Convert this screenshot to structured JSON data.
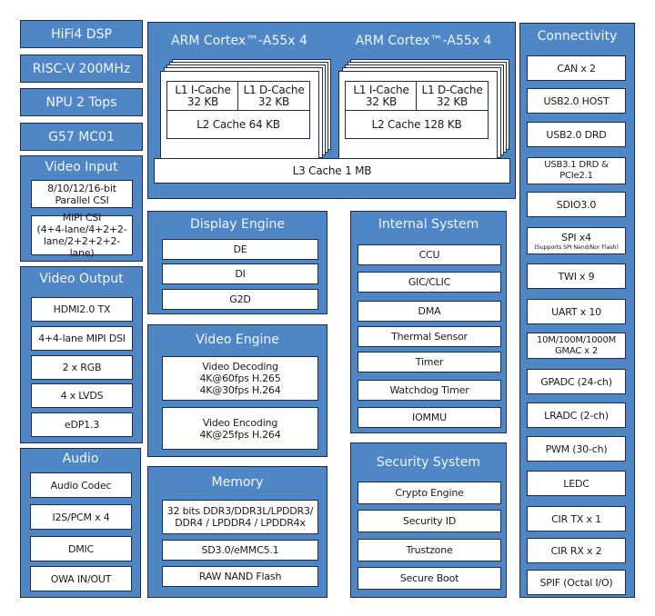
{
  "colors": {
    "block_fill": "#4f86c6",
    "border": "#1f2d44",
    "title_text": "#f2f6fb",
    "cell_fill": "#ffffff"
  },
  "left": {
    "standalone": [
      "HiFi4 DSP",
      "RISC-V 200MHz",
      "NPU 2 Tops",
      "G57 MC01"
    ],
    "video_input": {
      "title": "Video Input",
      "items": [
        [
          "8/10/12/16-bit",
          "Parallel CSI"
        ],
        [
          "MIPI CSI",
          "(4+4-lane/4+2+2-",
          "lane/2+2+2+2-lane)"
        ]
      ]
    },
    "video_output": {
      "title": "Video Output",
      "items": [
        "HDMI2.0 TX",
        "4+4-lane MIPI DSI",
        "2 x RGB",
        "4 x LVDS",
        "eDP1.3"
      ]
    },
    "audio": {
      "title": "Audio",
      "items": [
        "Audio Codec",
        "I2S/PCM x 4",
        "DMIC",
        "OWA IN/OUT"
      ]
    }
  },
  "cpu": {
    "clusters": [
      {
        "title": "ARM Cortex™-A55x 4",
        "l1i": [
          "L1 I-Cache",
          "32 KB"
        ],
        "l1d": [
          "L1 D-Cache",
          "32 KB"
        ],
        "l2": "L2 Cache 64 KB"
      },
      {
        "title": "ARM Cortex™-A55x 4",
        "l1i": [
          "L1 I-Cache",
          "32 KB"
        ],
        "l1d": [
          "L1 D-Cache",
          "32 KB"
        ],
        "l2": "L2 Cache 128 KB"
      }
    ],
    "l3": "L3 Cache 1 MB"
  },
  "display_engine": {
    "title": "Display Engine",
    "items": [
      "DE",
      "DI",
      "G2D"
    ]
  },
  "video_engine": {
    "title": "Video Engine",
    "items": [
      [
        "Video Decoding",
        "4K@60fps H.265",
        "4K@30fps H.264"
      ],
      [
        "Video Encoding",
        "4K@25fps H.264"
      ]
    ]
  },
  "memory": {
    "title": "Memory",
    "items": [
      [
        "32 bits DDR3/DDR3L/LPDDR3/",
        "DDR4 / LPDDR4 / LPDDR4x"
      ],
      [
        "SD3.0/eMMC5.1"
      ],
      [
        "RAW NAND Flash"
      ]
    ]
  },
  "internal_system": {
    "title": "Internal System",
    "items": [
      "CCU",
      "GIC/CLIC",
      "DMA",
      "Thermal Sensor",
      "Timer",
      "Watchdog Timer",
      "IOMMU"
    ]
  },
  "security_system": {
    "title": "Security System",
    "items": [
      "Crypto Engine",
      "Security ID",
      "Trustzone",
      "Secure Boot"
    ]
  },
  "connectivity": {
    "title": "Connectivity",
    "items": [
      [
        "CAN x 2"
      ],
      [
        "USB2.0 HOST"
      ],
      [
        "USB2.0 DRD"
      ],
      [
        "USB3.1 DRD &",
        "PCIe2.1"
      ],
      [
        "SDIO3.0"
      ],
      [
        "SPI x4"
      ],
      [
        "TWI x 9"
      ],
      [
        "UART x 10"
      ],
      [
        "10M/100M/1000M",
        "GMAC x 2"
      ],
      [
        "GPADC (24-ch)"
      ],
      [
        "LRADC (2-ch)"
      ],
      [
        "PWM (30-ch)"
      ],
      [
        "LEDC"
      ],
      [
        "CIR TX x 1"
      ],
      [
        "CIR RX x 2"
      ],
      [
        "SPIF (Octal I/O)"
      ]
    ],
    "spi_note": "(Supports SPI Nand/Nor Flash)"
  }
}
